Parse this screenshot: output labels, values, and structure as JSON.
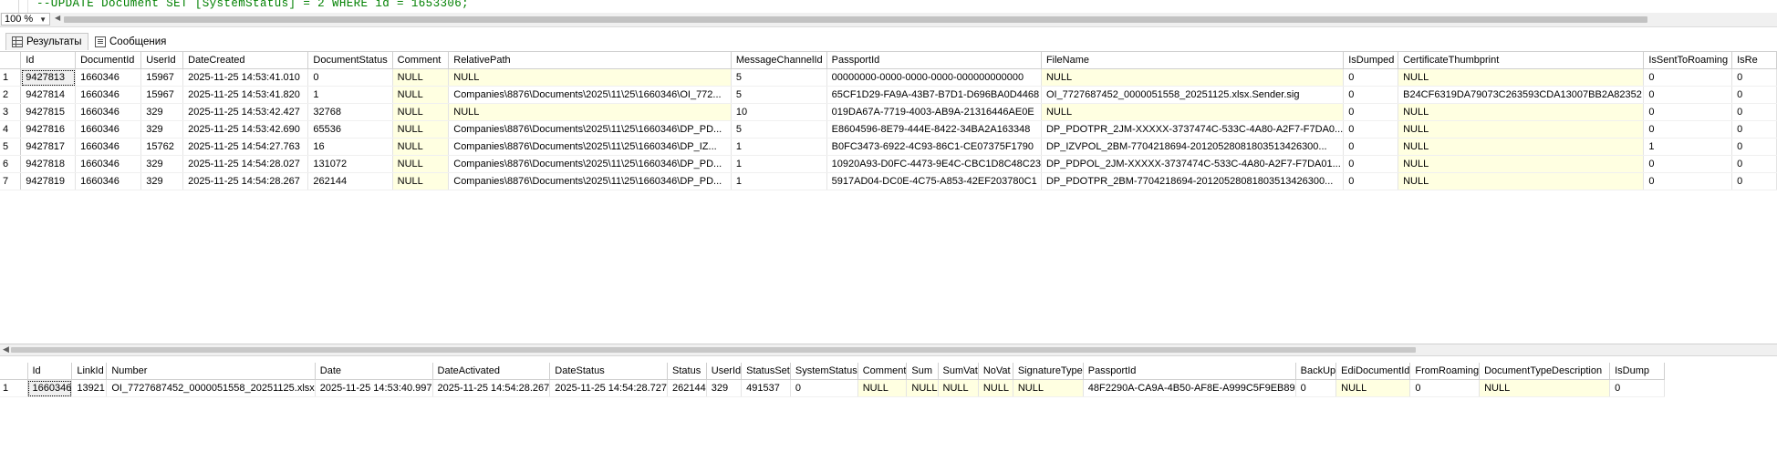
{
  "editor": {
    "code_line": "--UPDATE Document SET [SystemStatus] = 2 WHERE id = 1653306;"
  },
  "zoom": {
    "value": "100 %"
  },
  "tabs": [
    {
      "label": "Результаты",
      "icon": "grid-icon"
    },
    {
      "label": "Сообщения",
      "icon": "messages-icon"
    }
  ],
  "grid1": {
    "columns": [
      "Id",
      "DocumentId",
      "UserId",
      "DateCreated",
      "DocumentStatus",
      "Comment",
      "RelativePath",
      "MessageChannelId",
      "PassportId",
      "FileName",
      "IsDumped",
      "CertificateThumbprint",
      "IsSentToRoaming",
      "IsRe"
    ],
    "rows": [
      [
        "9427813",
        "1660346",
        "15967",
        "2025-11-25 14:53:41.010",
        "0",
        "NULL",
        "NULL",
        "5",
        "00000000-0000-0000-0000-000000000000",
        "NULL",
        "0",
        "NULL",
        "0",
        "0"
      ],
      [
        "9427814",
        "1660346",
        "15967",
        "2025-11-25 14:53:41.820",
        "1",
        "NULL",
        "Companies\\8876\\Documents\\2025\\11\\25\\1660346\\OI_772...",
        "5",
        "65CF1D29-FA9A-43B7-B7D1-D696BA0D4468",
        "OI_7727687452_0000051558_20251125.xlsx.Sender.sig",
        "0",
        "B24CF6319DA79073C263593CDA13007BB2A82352",
        "0",
        "0"
      ],
      [
        "9427815",
        "1660346",
        "329",
        "2025-11-25 14:53:42.427",
        "32768",
        "NULL",
        "NULL",
        "10",
        "019DA67A-7719-4003-AB9A-21316446AE0E",
        "NULL",
        "0",
        "NULL",
        "0",
        "0"
      ],
      [
        "9427816",
        "1660346",
        "329",
        "2025-11-25 14:53:42.690",
        "65536",
        "NULL",
        "Companies\\8876\\Documents\\2025\\11\\25\\1660346\\DP_PD...",
        "5",
        "E8604596-8E79-444E-8422-34BA2A163348",
        "DP_PDOTPR_2JM-XXXXX-3737474C-533C-4A80-A2F7-F7DA0...",
        "0",
        "NULL",
        "0",
        "0"
      ],
      [
        "9427817",
        "1660346",
        "15762",
        "2025-11-25 14:54:27.763",
        "16",
        "NULL",
        "Companies\\8876\\Documents\\2025\\11\\25\\1660346\\DP_IZ...",
        "1",
        "B0FC3473-6922-4C93-86C1-CE07375F1790",
        "DP_IZVPOL_2BM-7704218694-20120528081803513426300...",
        "0",
        "NULL",
        "1",
        "0"
      ],
      [
        "9427818",
        "1660346",
        "329",
        "2025-11-25 14:54:28.027",
        "131072",
        "NULL",
        "Companies\\8876\\Documents\\2025\\11\\25\\1660346\\DP_PD...",
        "1",
        "10920A93-D0FC-4473-9E4C-CBC1D8C48C23",
        "DP_PDPOL_2JM-XXXXX-3737474C-533C-4A80-A2F7-F7DA01...",
        "0",
        "NULL",
        "0",
        "0"
      ],
      [
        "9427819",
        "1660346",
        "329",
        "2025-11-25 14:54:28.267",
        "262144",
        "NULL",
        "Companies\\8876\\Documents\\2025\\11\\25\\1660346\\DP_PD...",
        "1",
        "5917AD04-DC0E-4C75-A853-42EF203780C1",
        "DP_PDOTPR_2BM-7704218694-20120528081803513426300...",
        "0",
        "NULL",
        "0",
        "0"
      ]
    ]
  },
  "grid2": {
    "columns": [
      "Id",
      "LinkId",
      "Number",
      "Date",
      "DateActivated",
      "DateStatus",
      "Status",
      "UserId",
      "StatusSet",
      "SystemStatus",
      "Comment",
      "Sum",
      "SumVat",
      "NoVat",
      "SignatureType",
      "PassportId",
      "BackUp",
      "EdiDocumentId",
      "FromRoaming",
      "DocumentTypeDescription",
      "IsDump"
    ],
    "rows": [
      [
        "1660346",
        "13921",
        "OI_7727687452_0000051558_20251125.xlsx",
        "2025-11-25 14:53:40.997",
        "2025-11-25 14:54:28.267",
        "2025-11-25 14:54:28.727",
        "262144",
        "329",
        "491537",
        "0",
        "NULL",
        "NULL",
        "NULL",
        "NULL",
        "NULL",
        "48F2290A-CA9A-4B50-AF8E-A999C5F9EB89",
        "0",
        "NULL",
        "0",
        "NULL",
        "0"
      ]
    ]
  }
}
